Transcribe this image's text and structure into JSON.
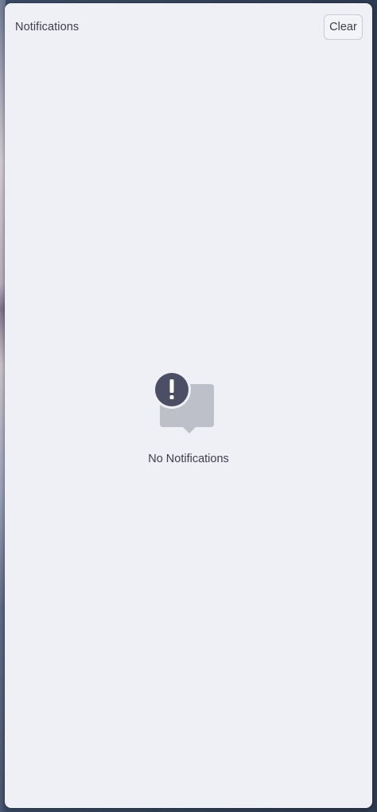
{
  "panel": {
    "title": "Notifications",
    "clear_label": "Clear"
  },
  "empty_state": {
    "icon": "notification-bubble-alert-icon",
    "label": "No Notifications"
  },
  "colors": {
    "panel_background": "#eff0f5",
    "text": "#3c3f4b",
    "icon_bubble": "#bdbfc9",
    "icon_badge": "#4c4e66"
  }
}
